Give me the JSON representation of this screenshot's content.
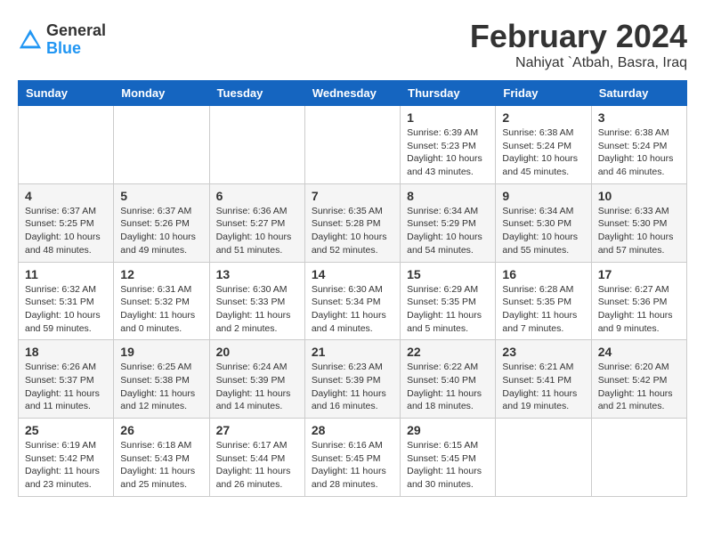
{
  "header": {
    "logo_general": "General",
    "logo_blue": "Blue",
    "month": "February 2024",
    "location": "Nahiyat `Atbah, Basra, Iraq"
  },
  "weekdays": [
    "Sunday",
    "Monday",
    "Tuesday",
    "Wednesday",
    "Thursday",
    "Friday",
    "Saturday"
  ],
  "weeks": [
    [
      {
        "day": "",
        "info": ""
      },
      {
        "day": "",
        "info": ""
      },
      {
        "day": "",
        "info": ""
      },
      {
        "day": "",
        "info": ""
      },
      {
        "day": "1",
        "info": "Sunrise: 6:39 AM\nSunset: 5:23 PM\nDaylight: 10 hours\nand 43 minutes."
      },
      {
        "day": "2",
        "info": "Sunrise: 6:38 AM\nSunset: 5:24 PM\nDaylight: 10 hours\nand 45 minutes."
      },
      {
        "day": "3",
        "info": "Sunrise: 6:38 AM\nSunset: 5:24 PM\nDaylight: 10 hours\nand 46 minutes."
      }
    ],
    [
      {
        "day": "4",
        "info": "Sunrise: 6:37 AM\nSunset: 5:25 PM\nDaylight: 10 hours\nand 48 minutes."
      },
      {
        "day": "5",
        "info": "Sunrise: 6:37 AM\nSunset: 5:26 PM\nDaylight: 10 hours\nand 49 minutes."
      },
      {
        "day": "6",
        "info": "Sunrise: 6:36 AM\nSunset: 5:27 PM\nDaylight: 10 hours\nand 51 minutes."
      },
      {
        "day": "7",
        "info": "Sunrise: 6:35 AM\nSunset: 5:28 PM\nDaylight: 10 hours\nand 52 minutes."
      },
      {
        "day": "8",
        "info": "Sunrise: 6:34 AM\nSunset: 5:29 PM\nDaylight: 10 hours\nand 54 minutes."
      },
      {
        "day": "9",
        "info": "Sunrise: 6:34 AM\nSunset: 5:30 PM\nDaylight: 10 hours\nand 55 minutes."
      },
      {
        "day": "10",
        "info": "Sunrise: 6:33 AM\nSunset: 5:30 PM\nDaylight: 10 hours\nand 57 minutes."
      }
    ],
    [
      {
        "day": "11",
        "info": "Sunrise: 6:32 AM\nSunset: 5:31 PM\nDaylight: 10 hours\nand 59 minutes."
      },
      {
        "day": "12",
        "info": "Sunrise: 6:31 AM\nSunset: 5:32 PM\nDaylight: 11 hours\nand 0 minutes."
      },
      {
        "day": "13",
        "info": "Sunrise: 6:30 AM\nSunset: 5:33 PM\nDaylight: 11 hours\nand 2 minutes."
      },
      {
        "day": "14",
        "info": "Sunrise: 6:30 AM\nSunset: 5:34 PM\nDaylight: 11 hours\nand 4 minutes."
      },
      {
        "day": "15",
        "info": "Sunrise: 6:29 AM\nSunset: 5:35 PM\nDaylight: 11 hours\nand 5 minutes."
      },
      {
        "day": "16",
        "info": "Sunrise: 6:28 AM\nSunset: 5:35 PM\nDaylight: 11 hours\nand 7 minutes."
      },
      {
        "day": "17",
        "info": "Sunrise: 6:27 AM\nSunset: 5:36 PM\nDaylight: 11 hours\nand 9 minutes."
      }
    ],
    [
      {
        "day": "18",
        "info": "Sunrise: 6:26 AM\nSunset: 5:37 PM\nDaylight: 11 hours\nand 11 minutes."
      },
      {
        "day": "19",
        "info": "Sunrise: 6:25 AM\nSunset: 5:38 PM\nDaylight: 11 hours\nand 12 minutes."
      },
      {
        "day": "20",
        "info": "Sunrise: 6:24 AM\nSunset: 5:39 PM\nDaylight: 11 hours\nand 14 minutes."
      },
      {
        "day": "21",
        "info": "Sunrise: 6:23 AM\nSunset: 5:39 PM\nDaylight: 11 hours\nand 16 minutes."
      },
      {
        "day": "22",
        "info": "Sunrise: 6:22 AM\nSunset: 5:40 PM\nDaylight: 11 hours\nand 18 minutes."
      },
      {
        "day": "23",
        "info": "Sunrise: 6:21 AM\nSunset: 5:41 PM\nDaylight: 11 hours\nand 19 minutes."
      },
      {
        "day": "24",
        "info": "Sunrise: 6:20 AM\nSunset: 5:42 PM\nDaylight: 11 hours\nand 21 minutes."
      }
    ],
    [
      {
        "day": "25",
        "info": "Sunrise: 6:19 AM\nSunset: 5:42 PM\nDaylight: 11 hours\nand 23 minutes."
      },
      {
        "day": "26",
        "info": "Sunrise: 6:18 AM\nSunset: 5:43 PM\nDaylight: 11 hours\nand 25 minutes."
      },
      {
        "day": "27",
        "info": "Sunrise: 6:17 AM\nSunset: 5:44 PM\nDaylight: 11 hours\nand 26 minutes."
      },
      {
        "day": "28",
        "info": "Sunrise: 6:16 AM\nSunset: 5:45 PM\nDaylight: 11 hours\nand 28 minutes."
      },
      {
        "day": "29",
        "info": "Sunrise: 6:15 AM\nSunset: 5:45 PM\nDaylight: 11 hours\nand 30 minutes."
      },
      {
        "day": "",
        "info": ""
      },
      {
        "day": "",
        "info": ""
      }
    ]
  ]
}
